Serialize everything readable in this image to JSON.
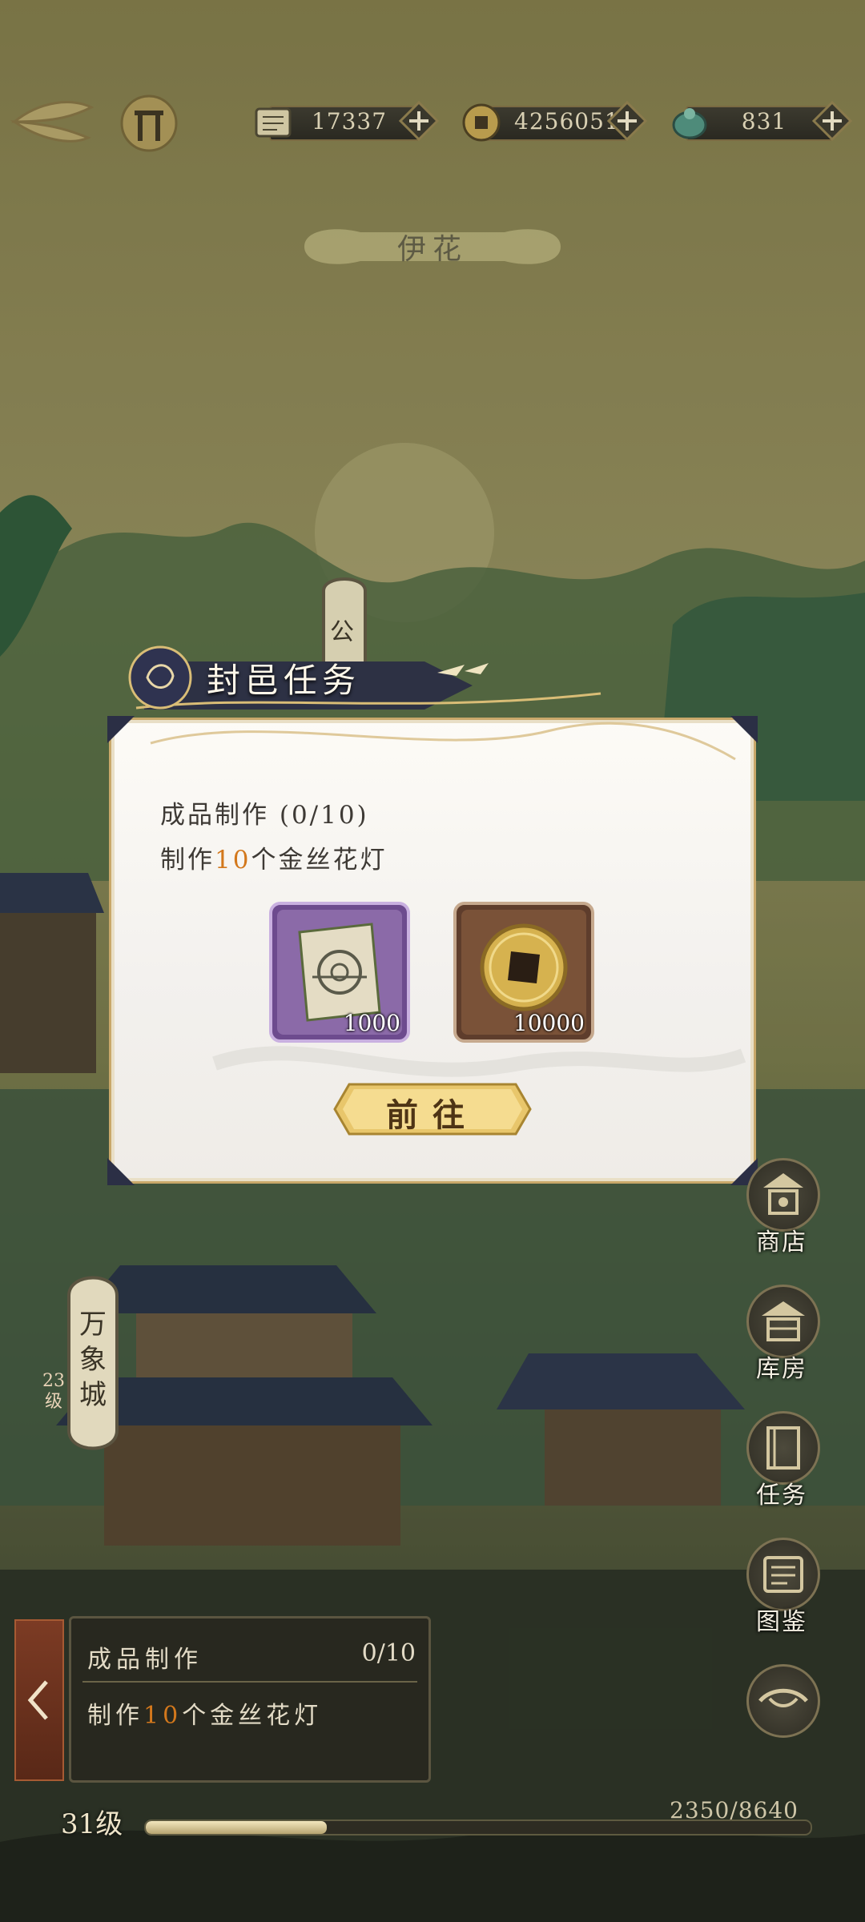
{
  "resources": [
    {
      "icon": "scroll-ticket-icon",
      "value": "17337"
    },
    {
      "icon": "copper-coin-icon",
      "value": "4256051"
    },
    {
      "icon": "jade-icon",
      "value": "831"
    }
  ],
  "place_name": "伊花",
  "notice_tag": "公",
  "modal": {
    "title": "封邑任务",
    "task_name": "成品制作 (0/10)",
    "desc_prefix": "制作",
    "desc_count": "10",
    "desc_suffix": "个金丝花灯",
    "rewards": [
      {
        "icon": "blueprint-scroll-icon",
        "quantity": "1000"
      },
      {
        "icon": "copper-coin-icon",
        "quantity": "10000"
      }
    ],
    "go_button": "前往"
  },
  "city": {
    "name": "万象城",
    "level": "23级"
  },
  "side_buttons": [
    {
      "label": "商店",
      "icon": "shop-icon"
    },
    {
      "label": "库房",
      "icon": "warehouse-icon"
    },
    {
      "label": "任务",
      "icon": "task-book-icon"
    },
    {
      "label": "图鉴",
      "icon": "encyclopedia-icon"
    }
  ],
  "tracker": {
    "name": "成品制作",
    "progress": "0/10",
    "desc_prefix": "制作",
    "desc_count": "10",
    "desc_suffix": "个金丝花灯"
  },
  "level": {
    "label": "31级",
    "xp_text": "2350/8640",
    "xp_fraction": 0.272
  },
  "colors": {
    "highlight": "#d3781c",
    "panel": "#f7f5f1",
    "gold": "#c9a86a"
  }
}
